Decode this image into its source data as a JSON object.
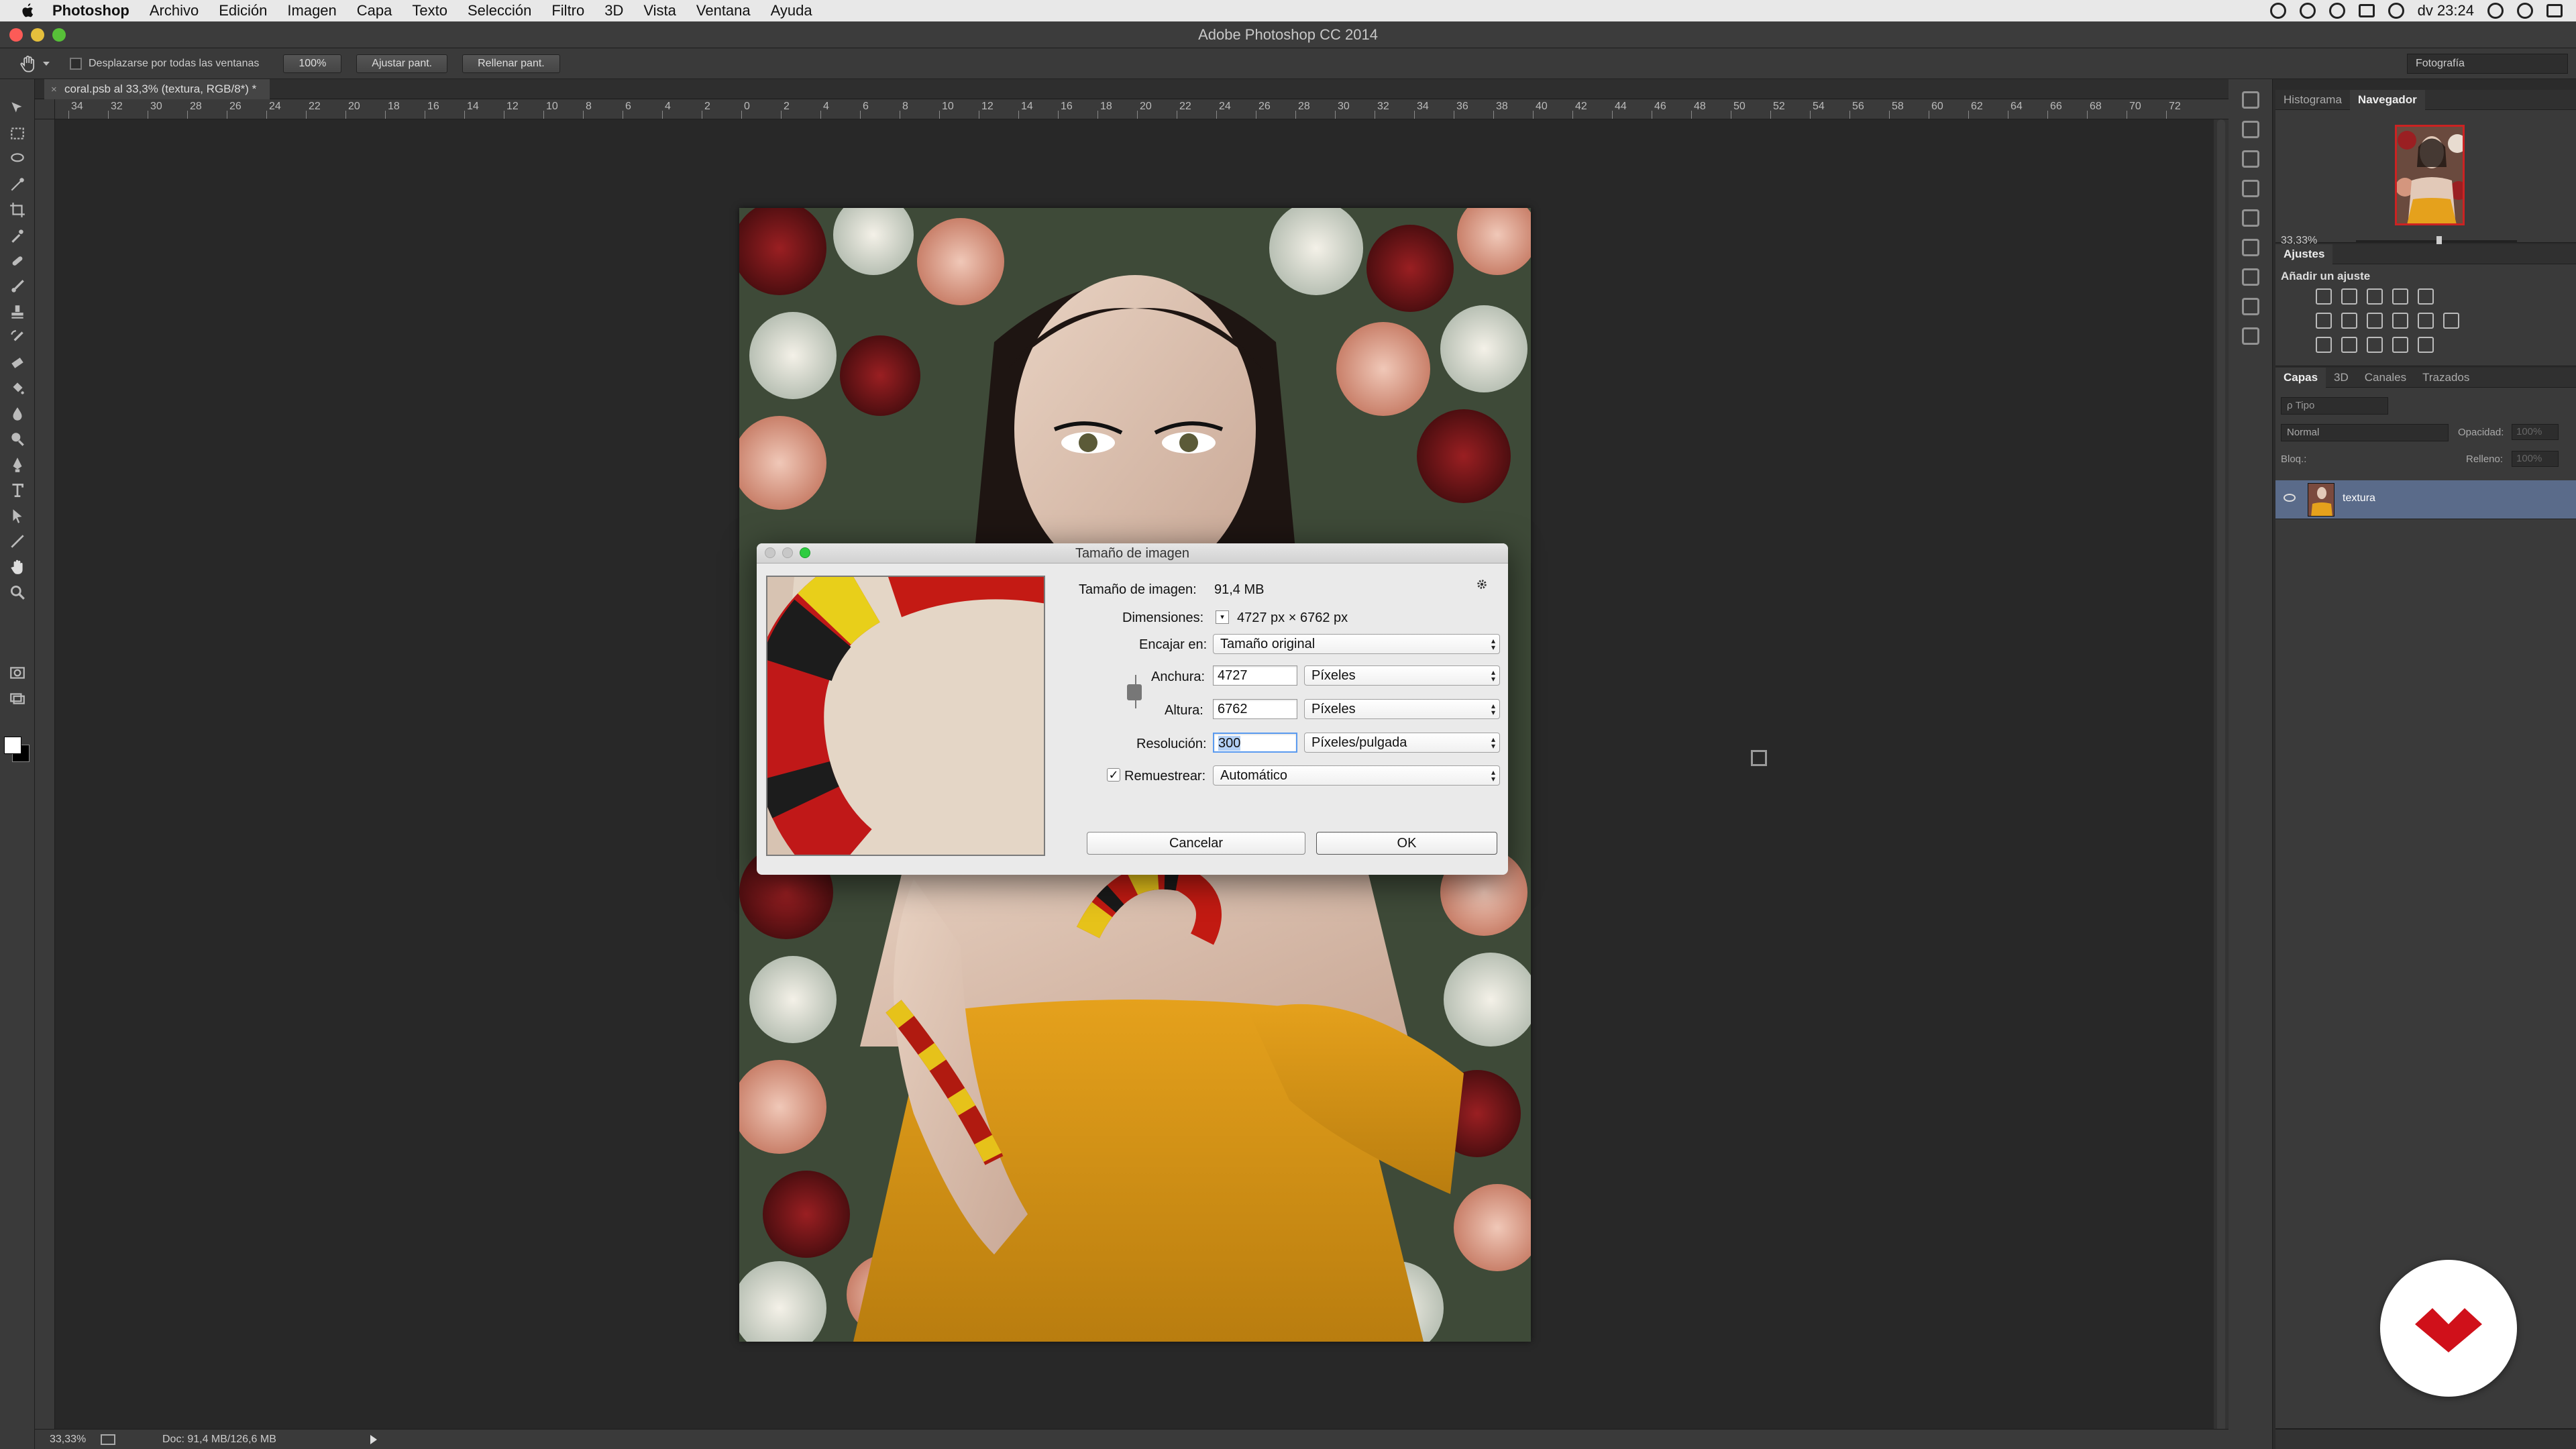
{
  "menubar": {
    "app": "Photoshop",
    "items": [
      "Archivo",
      "Edición",
      "Imagen",
      "Capa",
      "Texto",
      "Selección",
      "Filtro",
      "3D",
      "Vista",
      "Ventana",
      "Ayuda"
    ],
    "clock": "dv 23:24"
  },
  "window": {
    "title": "Adobe Photoshop CC 2014"
  },
  "options": {
    "scroll_all_label": "Desplazarse por todas las ventanas",
    "btn_100": "100%",
    "btn_fit": "Ajustar pant.",
    "btn_fill": "Rellenar pant.",
    "workspace": "Fotografía"
  },
  "document": {
    "tab_label": "coral.psb al 33,3% (textura, RGB/8*) *"
  },
  "ruler": {
    "labels": [
      "34",
      "32",
      "30",
      "28",
      "26",
      "24",
      "22",
      "20",
      "18",
      "16",
      "14",
      "12",
      "10",
      "8",
      "6",
      "4",
      "2",
      "0",
      "2",
      "4",
      "6",
      "8",
      "10",
      "12",
      "14",
      "16",
      "18",
      "20",
      "22",
      "24",
      "26",
      "28",
      "30",
      "32",
      "34",
      "36",
      "38",
      "40",
      "42",
      "44",
      "46",
      "48",
      "50",
      "52",
      "54",
      "56",
      "58",
      "60",
      "62",
      "64",
      "66",
      "68",
      "70",
      "72"
    ]
  },
  "status": {
    "zoom": "33,33%",
    "doc": "Doc: 91,4 MB/126,6 MB"
  },
  "dialog": {
    "title": "Tamaño de imagen",
    "size_label": "Tamaño de imagen:",
    "size_value": "91,4 MB",
    "dims_label": "Dimensiones:",
    "dims_value": "4727 px × 6762 px",
    "fit_label": "Encajar en:",
    "fit_value": "Tamaño original",
    "width_label": "Anchura:",
    "width_value": "4727",
    "width_unit": "Píxeles",
    "height_label": "Altura:",
    "height_value": "6762",
    "height_unit": "Píxeles",
    "res_label": "Resolución:",
    "res_value": "300",
    "res_unit": "Píxeles/pulgada",
    "resample_label": "Remuestrear:",
    "resample_value": "Automático",
    "resample_checked": true,
    "cancel": "Cancelar",
    "ok": "OK"
  },
  "panels": {
    "navigator_tabs": [
      "Histograma",
      "Navegador"
    ],
    "navigator_zoom": "33,33%",
    "adjustments_tab": "Ajustes",
    "adjustments_heading": "Añadir un ajuste",
    "layers_tabs": [
      "Capas",
      "3D",
      "Canales",
      "Trazados"
    ],
    "layer_filter": "ρ Tipo",
    "blend_mode": "Normal",
    "opacity_label": "Opacidad:",
    "opacity_value": "100%",
    "lock_label": "Bloq.:",
    "fill_label": "Relleno:",
    "fill_value": "100%",
    "layer_name": "textura"
  },
  "colors": {
    "menubar": "#e8e8e8",
    "panel": "#3a3a3a",
    "canvas": "#282828",
    "layer_selected": "#5a6b8a",
    "brand_red": "#d0101a"
  }
}
